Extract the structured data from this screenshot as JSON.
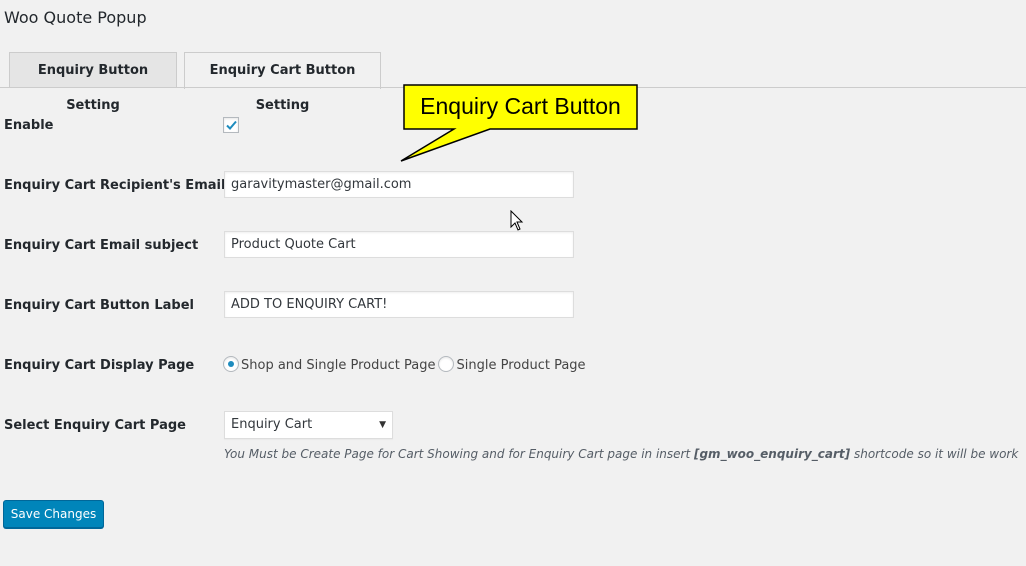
{
  "page": {
    "title": "Woo Quote Popup"
  },
  "tabs": [
    {
      "label": "Enquiry Button Setting",
      "active": false
    },
    {
      "label": "Enquiry Cart Button Setting",
      "active": true
    }
  ],
  "callout": {
    "text": "Enquiry Cart Button",
    "fill_color": "#ffff00"
  },
  "form": {
    "enable": {
      "label": "Enable",
      "checked": true
    },
    "recipient_email": {
      "label": "Enquiry Cart Recipient's Email",
      "value": "garavitymaster@gmail.com"
    },
    "email_subject": {
      "label": "Enquiry Cart Email subject",
      "value": "Product Quote Cart"
    },
    "button_label": {
      "label": "Enquiry Cart Button Label",
      "value": "ADD TO ENQUIRY CART!"
    },
    "display_page": {
      "label": "Enquiry Cart Display Page",
      "options": [
        {
          "label": "Shop and Single Product Page",
          "checked": true
        },
        {
          "label": "Single Product Page",
          "checked": false
        }
      ]
    },
    "cart_page": {
      "label": "Select Enquiry Cart Page",
      "selected": "Enquiry Cart",
      "description_before": "You Must be Create Page for Cart Showing and for Enquiry Cart page in insert ",
      "description_code": "[gm_woo_enquiry_cart]",
      "description_after": " shortcode so it will be work"
    }
  },
  "save_button": {
    "label": "Save Changes",
    "color": "#0085ba"
  }
}
